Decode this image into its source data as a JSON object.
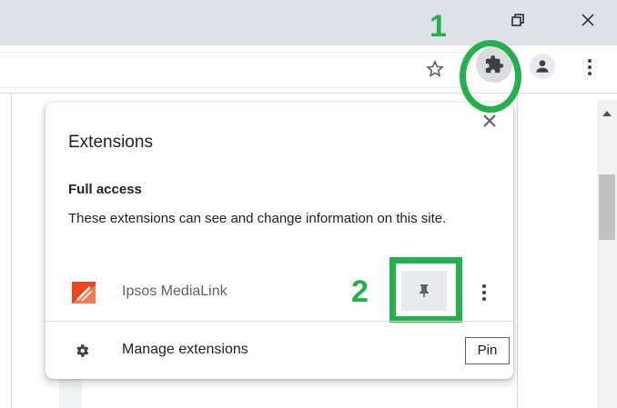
{
  "annotations": {
    "step1": "1",
    "step2": "2"
  },
  "window": {
    "restore_icon": "restore-icon",
    "close_icon": "close-icon"
  },
  "toolbar": {
    "bookmark_icon": "star-icon",
    "extensions_icon": "puzzle-icon",
    "profile_icon": "person-icon",
    "menu_icon": "kebab-menu-icon"
  },
  "extensions_popup": {
    "title": "Extensions",
    "close_icon": "close-icon",
    "section_title": "Full access",
    "section_description": "These extensions can see and change information on this site.",
    "extensions": [
      {
        "name": "Ipsos MediaLink",
        "pin_icon": "pin-icon",
        "more_icon": "kebab-menu-icon"
      }
    ],
    "manage_label": "Manage extensions",
    "manage_icon": "gear-icon"
  },
  "tooltip": {
    "text": "Pin"
  },
  "colors": {
    "annotation_green": "#22b14c",
    "titlebar": "#dee1e6",
    "logo_orange": "#e8471f"
  }
}
